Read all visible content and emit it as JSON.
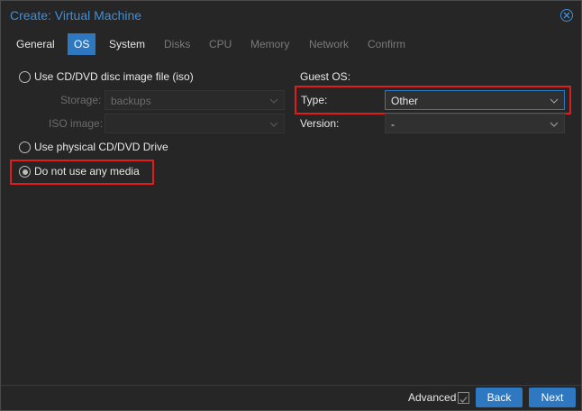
{
  "window": {
    "title": "Create: Virtual Machine"
  },
  "tabs": [
    {
      "label": "General",
      "state": "normal"
    },
    {
      "label": "OS",
      "state": "active"
    },
    {
      "label": "System",
      "state": "normal"
    },
    {
      "label": "Disks",
      "state": "disabled"
    },
    {
      "label": "CPU",
      "state": "disabled"
    },
    {
      "label": "Memory",
      "state": "disabled"
    },
    {
      "label": "Network",
      "state": "disabled"
    },
    {
      "label": "Confirm",
      "state": "disabled"
    }
  ],
  "media": {
    "iso_option": "Use CD/DVD disc image file (iso)",
    "storage_label": "Storage:",
    "storage_value": "backups",
    "iso_label": "ISO image:",
    "iso_value": "",
    "physical_option": "Use physical CD/DVD Drive",
    "none_option": "Do not use any media",
    "selected": "none"
  },
  "guest_os": {
    "heading": "Guest OS:",
    "type_label": "Type:",
    "type_value": "Other",
    "version_label": "Version:",
    "version_value": "-"
  },
  "footer": {
    "advanced_label": "Advanced",
    "advanced_checked": true,
    "back_label": "Back",
    "next_label": "Next"
  },
  "colors": {
    "accent": "#2d78c1",
    "title": "#3f8fd6",
    "highlight": "#e31b1b",
    "background": "#262626"
  }
}
